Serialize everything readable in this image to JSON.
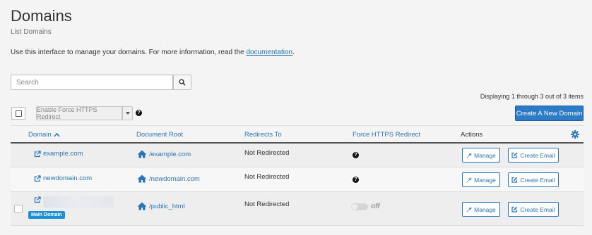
{
  "page": {
    "title": "Domains",
    "subtitle": "List Domains",
    "intro_text": "Use this interface to manage your domains. For more information, read the ",
    "intro_link": "documentation",
    "intro_end": "."
  },
  "search": {
    "placeholder": "Search",
    "value": ""
  },
  "toolbar": {
    "displaying": "Displaying 1 through 3 out of 3 items",
    "force_https_label": "Enable Force HTTPS Redirect",
    "create_label": "Create A New Domain"
  },
  "table": {
    "headers": {
      "domain": "Domain",
      "document_root": "Document Root",
      "redirects_to": "Redirects To",
      "force_https": "Force HTTPS Redirect",
      "actions": "Actions"
    },
    "rows": [
      {
        "domain": "example.com",
        "document_root": "/example.com",
        "redirects_to": "Not Redirected",
        "manage": "Manage",
        "create_email": "Create Email"
      },
      {
        "domain": "newdomain.com",
        "document_root": "/newdomain.com",
        "redirects_to": "Not Redirected",
        "manage": "Manage",
        "create_email": "Create Email"
      },
      {
        "domain": "",
        "badge": "Main Domain",
        "document_root": "/public_html",
        "redirects_to": "Not Redirected",
        "force_https_state": "off",
        "manage": "Manage",
        "create_email": "Create Email"
      }
    ]
  },
  "colors": {
    "accent": "#2d74b7",
    "primary_button": "#2d7ac8",
    "badge": "#1e8fd6"
  },
  "icons": [
    "search-icon",
    "caret-down-icon",
    "help-icon",
    "sort-asc-icon",
    "settings-gear-icon",
    "external-link-icon",
    "home-icon",
    "wrench-icon",
    "edit-icon"
  ]
}
